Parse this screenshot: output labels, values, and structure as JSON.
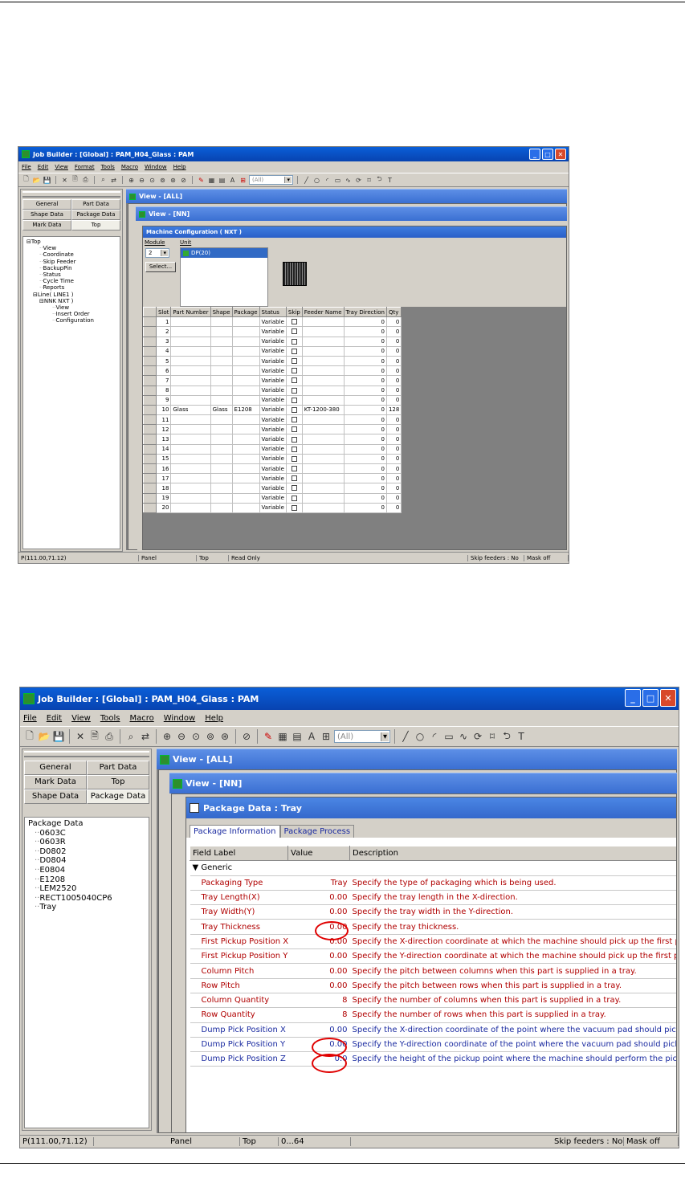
{
  "shot1": {
    "title": "Job Builder : [Global] : PAM_H04_Glass : PAM",
    "menu": [
      "File",
      "Edit",
      "View",
      "Format",
      "Tools",
      "Macro",
      "Window",
      "Help"
    ],
    "toolbar_combo": "(All)",
    "tabs": [
      "General",
      "Part Data",
      "Shape Data",
      "Package Data",
      "Mark Data",
      "Top"
    ],
    "selected_tab": "Top",
    "tree": [
      {
        "label": "Top",
        "indent": 0,
        "expander": "⊟"
      },
      {
        "label": "View",
        "indent": 2
      },
      {
        "label": "Coordinate",
        "indent": 2
      },
      {
        "label": "Skip Feeder",
        "indent": 2
      },
      {
        "label": "BackupPin",
        "indent": 2
      },
      {
        "label": "Status",
        "indent": 2
      },
      {
        "label": "Cycle Time",
        "indent": 2
      },
      {
        "label": "Reports",
        "indent": 2
      },
      {
        "label": "Line( LINE1 )",
        "indent": 1,
        "expander": "⊟"
      },
      {
        "label": "NNK NXT )",
        "indent": 2,
        "expander": "⊟"
      },
      {
        "label": "View",
        "indent": 4
      },
      {
        "label": "Insert Order",
        "indent": 4
      },
      {
        "label": "Configuration",
        "indent": 4
      }
    ],
    "view_all_title": "View - [ALL]",
    "view_nn_title": "View - [NN]",
    "machine_config_title": "Machine Configuration ( NXT )",
    "module_label": "Module",
    "unit_label": "Unit",
    "module_value": "2",
    "select_button": "Select...",
    "unit_item": "DP(20)",
    "columns": [
      "Slot",
      "Part Number",
      "Shape",
      "Package",
      "Status",
      "Skip",
      "Feeder Name",
      "Tray Direction",
      "Qty"
    ],
    "rows": [
      {
        "slot": "1",
        "part": "",
        "shape": "",
        "package": "",
        "status": "Variable",
        "feeder": "",
        "dir": "0",
        "qty": "0"
      },
      {
        "slot": "2",
        "part": "",
        "shape": "",
        "package": "",
        "status": "Variable",
        "feeder": "",
        "dir": "0",
        "qty": "0"
      },
      {
        "slot": "3",
        "part": "",
        "shape": "",
        "package": "",
        "status": "Variable",
        "feeder": "",
        "dir": "0",
        "qty": "0"
      },
      {
        "slot": "4",
        "part": "",
        "shape": "",
        "package": "",
        "status": "Variable",
        "feeder": "",
        "dir": "0",
        "qty": "0"
      },
      {
        "slot": "5",
        "part": "",
        "shape": "",
        "package": "",
        "status": "Variable",
        "feeder": "",
        "dir": "0",
        "qty": "0"
      },
      {
        "slot": "6",
        "part": "",
        "shape": "",
        "package": "",
        "status": "Variable",
        "feeder": "",
        "dir": "0",
        "qty": "0"
      },
      {
        "slot": "7",
        "part": "",
        "shape": "",
        "package": "",
        "status": "Variable",
        "feeder": "",
        "dir": "0",
        "qty": "0"
      },
      {
        "slot": "8",
        "part": "",
        "shape": "",
        "package": "",
        "status": "Variable",
        "feeder": "",
        "dir": "0",
        "qty": "0"
      },
      {
        "slot": "9",
        "part": "",
        "shape": "",
        "package": "",
        "status": "Variable",
        "feeder": "",
        "dir": "0",
        "qty": "0"
      },
      {
        "slot": "10",
        "part": "Glass",
        "shape": "Glass",
        "package": "E1208",
        "status": "Variable",
        "feeder": "KT-1200-380",
        "dir": "0",
        "qty": "128"
      },
      {
        "slot": "11",
        "part": "",
        "shape": "",
        "package": "",
        "status": "Variable",
        "feeder": "",
        "dir": "0",
        "qty": "0"
      },
      {
        "slot": "12",
        "part": "",
        "shape": "",
        "package": "",
        "status": "Variable",
        "feeder": "",
        "dir": "0",
        "qty": "0"
      },
      {
        "slot": "13",
        "part": "",
        "shape": "",
        "package": "",
        "status": "Variable",
        "feeder": "",
        "dir": "0",
        "qty": "0"
      },
      {
        "slot": "14",
        "part": "",
        "shape": "",
        "package": "",
        "status": "Variable",
        "feeder": "",
        "dir": "0",
        "qty": "0"
      },
      {
        "slot": "15",
        "part": "",
        "shape": "",
        "package": "",
        "status": "Variable",
        "feeder": "",
        "dir": "0",
        "qty": "0"
      },
      {
        "slot": "16",
        "part": "",
        "shape": "",
        "package": "",
        "status": "Variable",
        "feeder": "",
        "dir": "0",
        "qty": "0"
      },
      {
        "slot": "17",
        "part": "",
        "shape": "",
        "package": "",
        "status": "Variable",
        "feeder": "",
        "dir": "0",
        "qty": "0"
      },
      {
        "slot": "18",
        "part": "",
        "shape": "",
        "package": "",
        "status": "Variable",
        "feeder": "",
        "dir": "0",
        "qty": "0"
      },
      {
        "slot": "19",
        "part": "",
        "shape": "",
        "package": "",
        "status": "Variable",
        "feeder": "",
        "dir": "0",
        "qty": "0"
      },
      {
        "slot": "20",
        "part": "",
        "shape": "",
        "package": "",
        "status": "Variable",
        "feeder": "",
        "dir": "0",
        "qty": "0"
      }
    ],
    "status": [
      "P(111.00,71.12)",
      "Panel",
      "Top",
      "Read Only",
      "Skip feeders : No",
      "Mask off"
    ]
  },
  "shot2": {
    "title": "Job Builder : [Global] : PAM_H04_Glass : PAM",
    "menu": [
      "File",
      "Edit",
      "View",
      "Tools",
      "Macro",
      "Window",
      "Help"
    ],
    "toolbar_combo": "(All)",
    "tabs": [
      "General",
      "Part Data",
      "Mark Data",
      "Top",
      "Shape Data",
      "Package Data"
    ],
    "selected_tab": "Package Data",
    "tree": [
      {
        "label": "Package Data",
        "indent": 0
      },
      {
        "label": "0603C",
        "indent": 1
      },
      {
        "label": "0603R",
        "indent": 1
      },
      {
        "label": "D0802",
        "indent": 1
      },
      {
        "label": "D0804",
        "indent": 1
      },
      {
        "label": "E0804",
        "indent": 1
      },
      {
        "label": "E1208",
        "indent": 1
      },
      {
        "label": "LEM2520",
        "indent": 1
      },
      {
        "label": "RECT1005040CP6",
        "indent": 1
      },
      {
        "label": "Tray",
        "indent": 1
      }
    ],
    "view_all_title": "View - [ALL]",
    "view_nn_title": "View - [NN]",
    "package_title": "Package Data : Tray",
    "inner_tabs": [
      "Package Information",
      "Package Process"
    ],
    "columns": [
      "Field Label",
      "Value",
      "Description"
    ],
    "group_label": "▼ Generic",
    "rows": [
      {
        "label": "Packaging Type",
        "value": "Tray",
        "desc": "Specify the type of packaging which is being used.",
        "color": "red"
      },
      {
        "label": "Tray Length(X)",
        "value": "0.00",
        "desc": "Specify the tray length in the X-direction.",
        "color": "red"
      },
      {
        "label": "Tray Width(Y)",
        "value": "0.00",
        "desc": "Specify the tray width in the Y-direction.",
        "color": "red"
      },
      {
        "label": "Tray Thickness",
        "value": "0.00",
        "desc": "Specify the tray thickness.",
        "color": "red"
      },
      {
        "label": "First Pickup Position X",
        "value": "0.00",
        "desc": "Specify the X-direction coordinate at which the machine should pick up the first part when th",
        "color": "red"
      },
      {
        "label": "First Pickup Position Y",
        "value": "0.00",
        "desc": "Specify the Y-direction coordinate at which the machine should pick up the first part when th",
        "color": "red"
      },
      {
        "label": "Column Pitch",
        "value": "0.00",
        "desc": "Specify the pitch between columns when this part is supplied in a tray.",
        "color": "red"
      },
      {
        "label": "Row Pitch",
        "value": "0.00",
        "desc": "Specify the pitch between rows when this part is supplied in a tray.",
        "color": "red"
      },
      {
        "label": "Column Quantity",
        "value": "8",
        "desc": "Specify the number of columns when this part is supplied in a tray.",
        "color": "red"
      },
      {
        "label": "Row Quantity",
        "value": "8",
        "desc": "Specify the number of rows when this part is supplied in a tray.",
        "color": "red"
      },
      {
        "label": "Dump Pick Position X",
        "value": "0.00",
        "desc": "Specify the X-direction coordinate of the point where the vacuum pad should pick up an emp",
        "color": "blue"
      },
      {
        "label": "Dump Pick Position Y",
        "value": "0.00",
        "desc": "Specify the Y-direction coordinate of the point where the vacuum pad should pick up an emp",
        "color": "blue"
      },
      {
        "label": "Dump Pick Position Z",
        "value": "0.0",
        "desc": "Specify the height of the pickup point where the machine should perform the pickup action w",
        "color": "blue"
      }
    ],
    "status": [
      "P(111.00,71.12)",
      "",
      "Panel",
      "Top",
      "0...64",
      "",
      "Skip feeders : No",
      "Mask off"
    ],
    "highlight_color": "#e00000"
  }
}
